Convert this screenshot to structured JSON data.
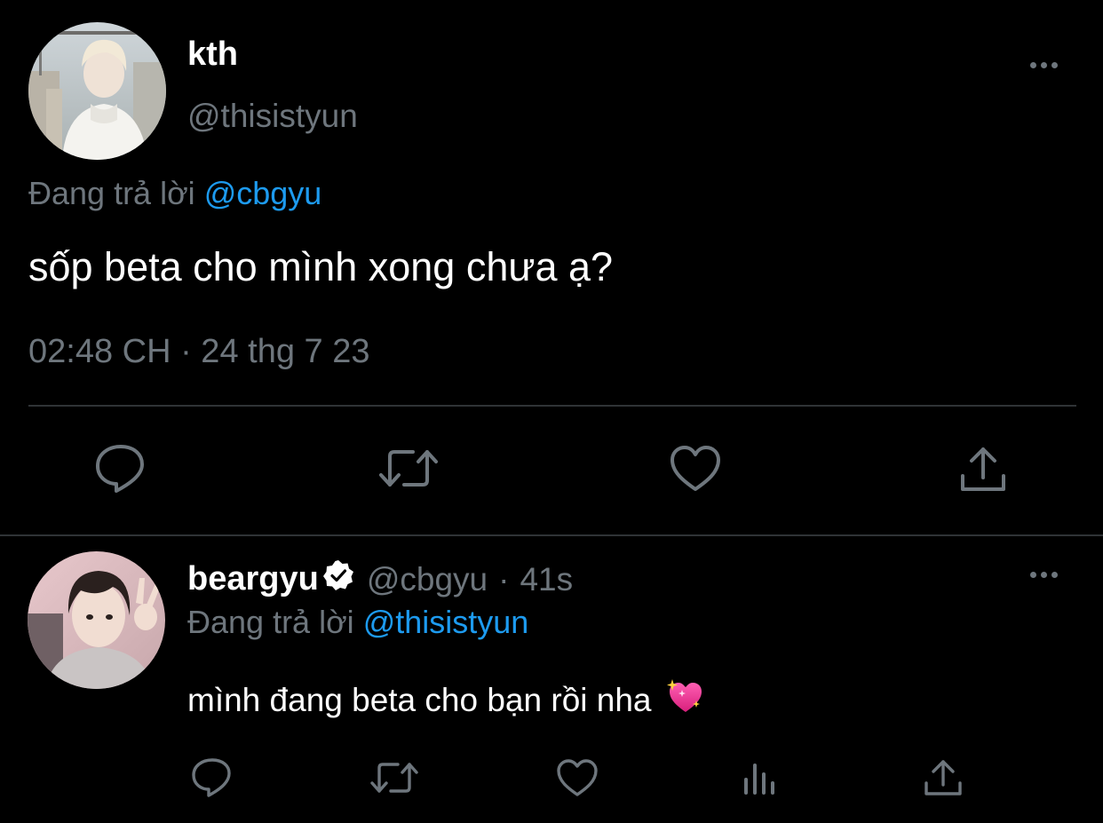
{
  "main_tweet": {
    "display_name": "kth",
    "handle": "@thisistyun",
    "replying_prefix": "Đang trả lời",
    "replying_to": "@cbgyu",
    "text": "sốp beta cho mình xong chưa ạ?",
    "timestamp": "02:48 CH · 24 thg 7 23",
    "actions": [
      "reply-icon",
      "retweet-icon",
      "like-icon",
      "share-icon"
    ]
  },
  "reply_tweet": {
    "display_name": "beargyu",
    "verified": true,
    "handle": "@cbgyu",
    "separator": "·",
    "age": "41s",
    "replying_prefix": "Đang trả lời",
    "replying_to": "@thisistyun",
    "text": "mình đang beta cho bạn rồi nha",
    "emoji": "sparkling-heart",
    "actions": [
      "reply-icon",
      "retweet-icon",
      "like-icon",
      "analytics-icon",
      "share-icon"
    ]
  },
  "colors": {
    "background": "#000000",
    "primary_text": "#ffffff",
    "secondary_text": "#6e767d",
    "mention": "#1d9bf0",
    "divider": "#2f3336"
  }
}
